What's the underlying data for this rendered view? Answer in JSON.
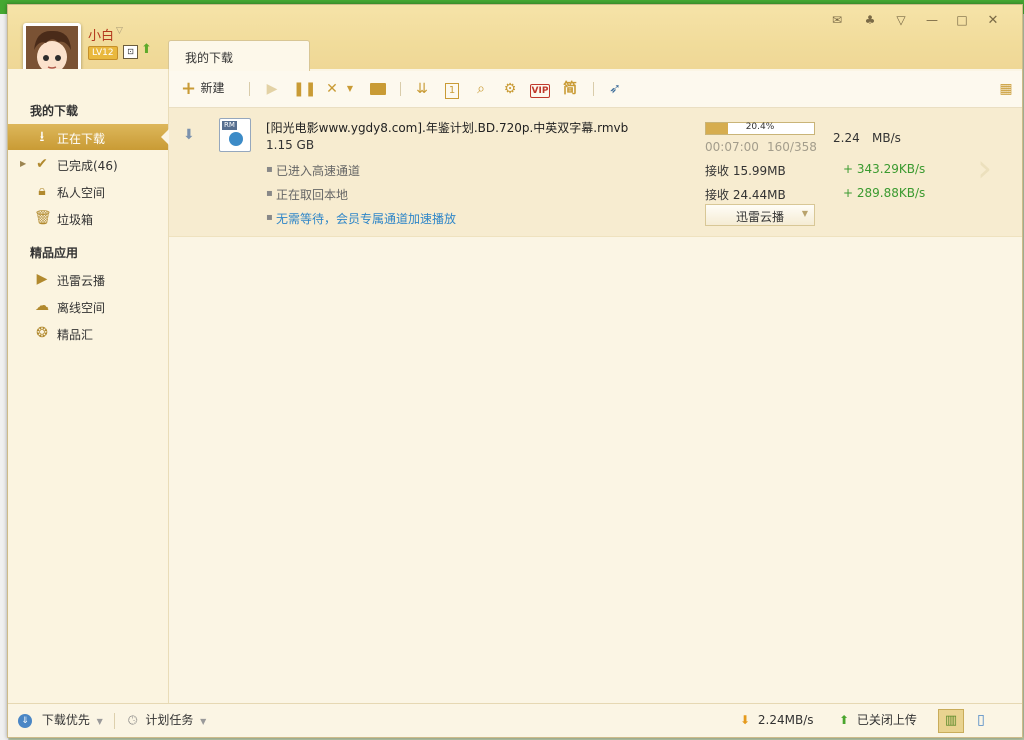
{
  "user": {
    "name": "小白",
    "level": "LV12"
  },
  "tab": {
    "label": "我的下载"
  },
  "toolbar": {
    "new_label": "新建",
    "simplified_label": "简",
    "vip_label": "VIP"
  },
  "sidebar": {
    "section1_title": "我的下载",
    "items": [
      {
        "label": "正在下载"
      },
      {
        "label": "已完成(46)"
      },
      {
        "label": "私人空间"
      },
      {
        "label": "垃圾箱"
      }
    ],
    "section2_title": "精品应用",
    "apps": [
      {
        "label": "迅雷云播"
      },
      {
        "label": "离线空间"
      },
      {
        "label": "精品汇"
      }
    ]
  },
  "download": {
    "filename": "[阳光电影www.ygdy8.com].年鉴计划.BD.720p.中英双字幕.rmvb",
    "file_type_tag": "RM",
    "size": "1.15 GB",
    "progress_text": "20.4%",
    "progress": 0.204,
    "time_remaining": "00:07:00",
    "pieces": "160/358",
    "speed": "2.24",
    "speed_unit": "MB/s",
    "status_lines": [
      "已进入高速通道",
      "正在取回本地",
      "无需等待，会员专属通道加速播放"
    ],
    "recv1_label": "接收 15.99MB",
    "recv1_rate": "+ 343.29KB/s",
    "recv2_label": "接收 24.44MB",
    "recv2_rate": "+ 289.88KB/s",
    "cloud_button": "迅雷云播"
  },
  "statusbar": {
    "priority_label": "下载优先",
    "schedule_label": "计划任务",
    "total_speed": "2.24MB/s",
    "upload_status": "已关闭上传"
  },
  "colors": {
    "accent": "#c99b35",
    "rate_green": "#3a9a2f",
    "link_blue": "#2f86c8",
    "name_red": "#b3381d"
  }
}
